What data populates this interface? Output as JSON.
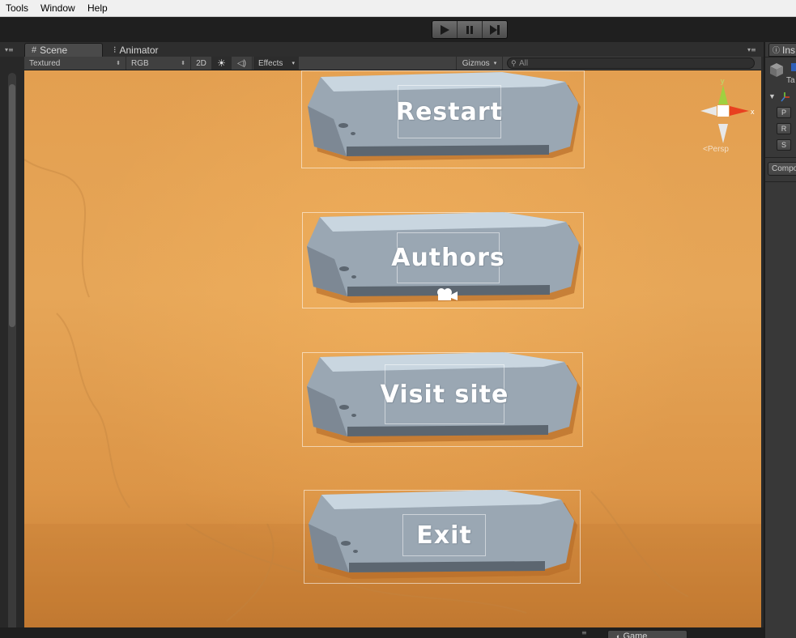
{
  "menu": {
    "items": [
      "Tools",
      "Window",
      "Help"
    ]
  },
  "scene_tabs": {
    "scene": "Scene",
    "animator": "Animator"
  },
  "scene_toolbar": {
    "draw_mode": "Textured",
    "render_mode": "RGB",
    "mode_2d": "2D",
    "effects": "Effects",
    "gizmos": "Gizmos",
    "search_placeholder": "All"
  },
  "scene": {
    "buttons": [
      {
        "label": "Restart"
      },
      {
        "label": "Authors"
      },
      {
        "label": "Visit  site"
      },
      {
        "label": "Exit"
      }
    ],
    "gizmo": {
      "y_axis": "y",
      "x_axis": "x",
      "projection": "Persp"
    }
  },
  "inspector": {
    "tab": "Ins",
    "tag_label": "Ta",
    "transform_buttons": [
      "P",
      "R",
      "S"
    ],
    "component_button": "Compo"
  },
  "bottom": {
    "game_tab": "Game"
  },
  "colors": {
    "scene_bg": "#e39f50",
    "stone": "#9aa7b3",
    "stone_dark": "#5c6670",
    "editor_bg": "#383838"
  }
}
